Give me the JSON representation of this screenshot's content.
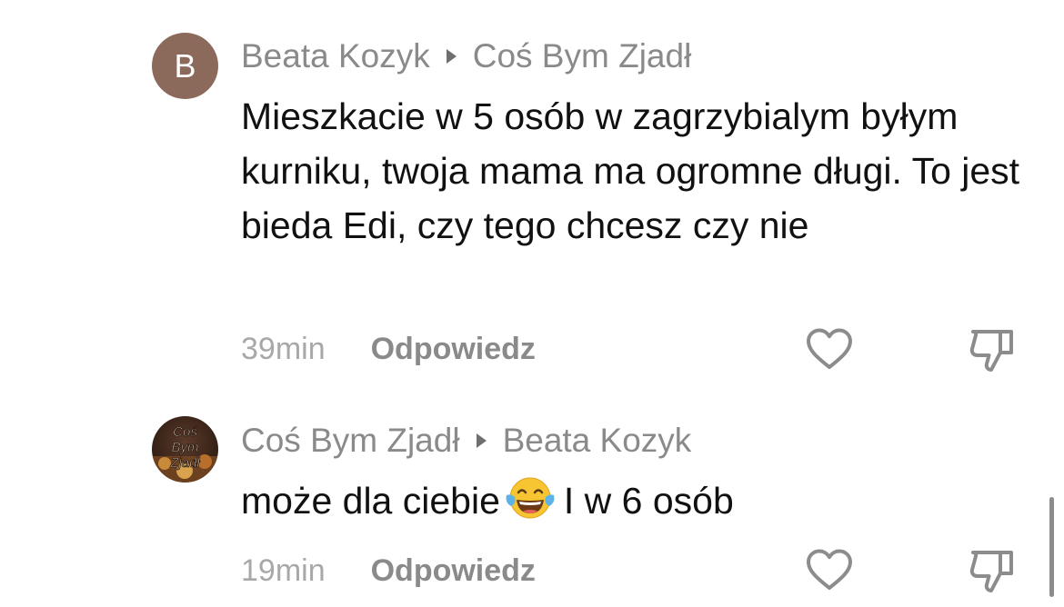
{
  "comments": [
    {
      "avatar_letter": "B",
      "author": "Beata Kozyk",
      "reply_to": "Coś Bym Zjadł",
      "text": "Mieszkacie w 5 osób w zagrzybialym byłym kurniku, twoja mama ma ogromne długi. To jest bieda Edi, czy tego chcesz czy nie",
      "time": "39min",
      "reply_label": "Odpowiedz"
    },
    {
      "avatar_text": [
        "Coś",
        "Bym",
        "Zjadł"
      ],
      "author": "Coś Bym Zjadł",
      "reply_to": "Beata Kozyk",
      "text_before": "może dla ciebie",
      "emoji": "face-with-tears-of-joy",
      "text_after": "I w 6 osób",
      "time": "19min",
      "reply_label": "Odpowiedz"
    }
  ],
  "icons": {
    "like": "heart-outline-icon",
    "dislike": "thumbs-down-outline-icon"
  },
  "colors": {
    "meta_gray": "#8a8a8a",
    "time_gray": "#a8a8a8",
    "avatar_b": "#8b6a5c"
  }
}
